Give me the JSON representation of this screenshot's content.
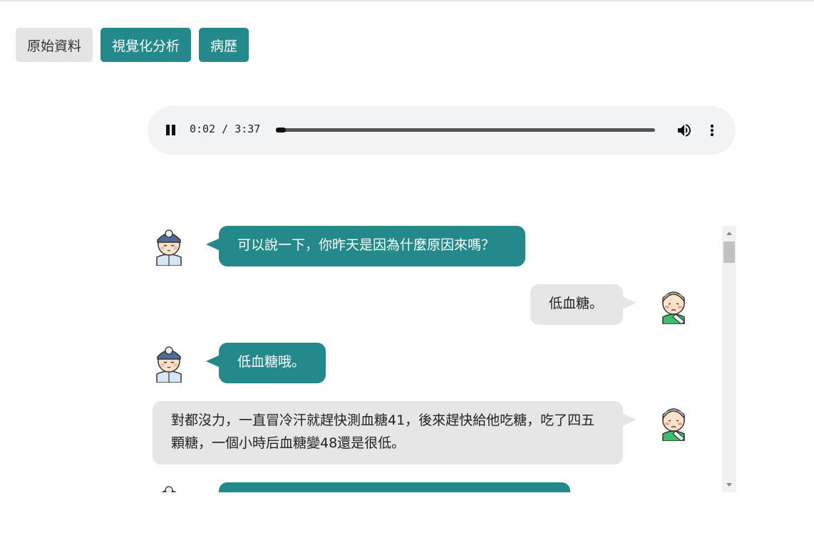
{
  "tabs": [
    {
      "label": "原始資料",
      "style": "gray"
    },
    {
      "label": "視覺化分析",
      "style": "teal"
    },
    {
      "label": "病歷",
      "style": "teal"
    }
  ],
  "player": {
    "time_display": "0:02 / 3:37",
    "progress_fraction": 0.009
  },
  "chat": {
    "messages": [
      {
        "speaker": "doctor",
        "text": "可以說一下，你昨天是因為什麼原因來嗎？"
      },
      {
        "speaker": "patient",
        "text": "低血糖。"
      },
      {
        "speaker": "doctor",
        "text": "低血糖哦。"
      },
      {
        "speaker": "patient",
        "text": "對都沒力，一直冒冷汗就趕快測血糖41，後來趕快給他吃糖，吃了四五顆糖，一個小時后血糖變48還是很低。"
      }
    ]
  },
  "colors": {
    "accent": "#23898a",
    "gray_bubble": "#e6e6e6",
    "tab_gray": "#e4e4e4",
    "player_bg": "#f1f3f4"
  },
  "icons": [
    "pause-icon",
    "volume-icon",
    "more-options-icon",
    "doctor-avatar",
    "patient-avatar"
  ]
}
